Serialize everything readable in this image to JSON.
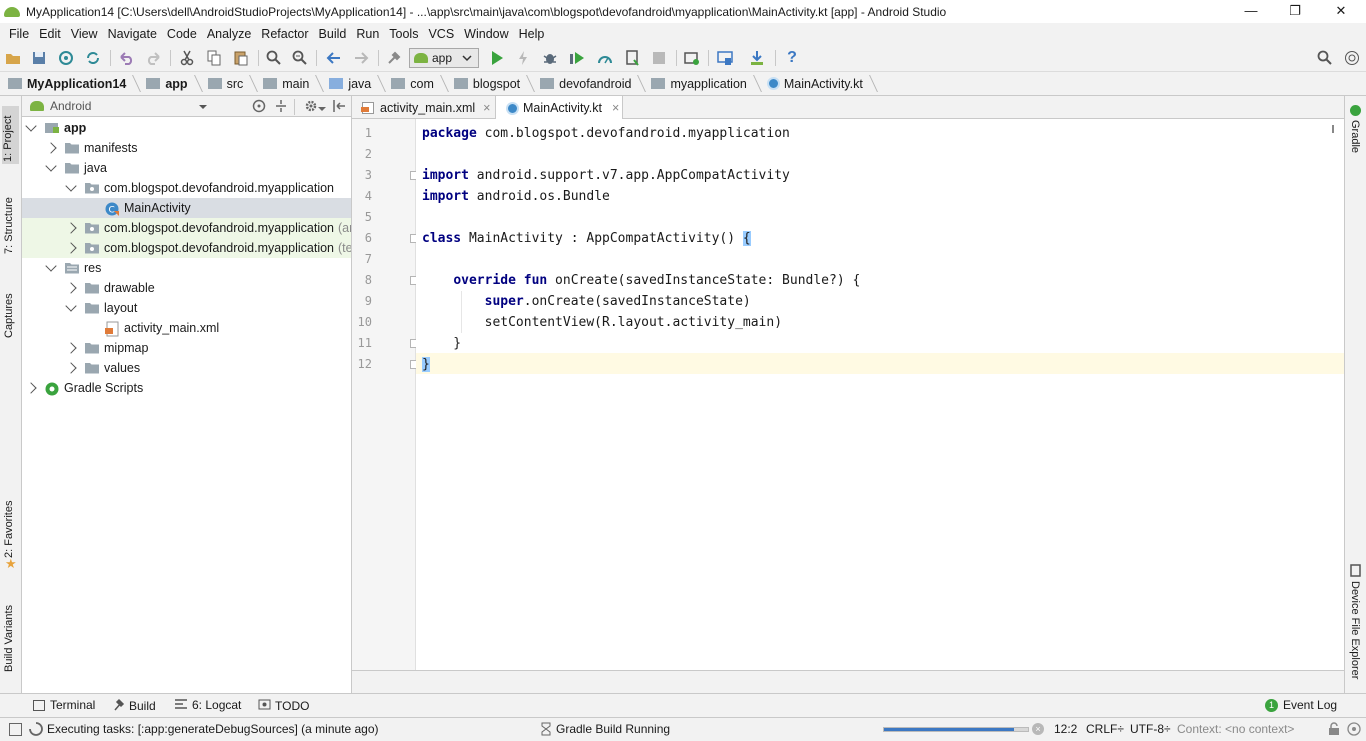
{
  "window": {
    "title": "MyApplication14 [C:\\Users\\dell\\AndroidStudioProjects\\MyApplication14] - ...\\app\\src\\main\\java\\com\\blogspot\\devofandroid\\myapplication\\MainActivity.kt [app] - Android Studio",
    "minimize": "—",
    "maximize": "❐",
    "close": "✕"
  },
  "menu": [
    "File",
    "Edit",
    "View",
    "Navigate",
    "Code",
    "Analyze",
    "Refactor",
    "Build",
    "Run",
    "Tools",
    "VCS",
    "Window",
    "Help"
  ],
  "toolbar": {
    "run_config": "app",
    "help": "?"
  },
  "breadcrumb": [
    "MyApplication14",
    "app",
    "src",
    "main",
    "java",
    "com",
    "blogspot",
    "devofandroid",
    "myapplication",
    "MainActivity.kt"
  ],
  "left_stripe": [
    "1: Project",
    "7: Structure",
    "Captures",
    "2: Favorites",
    "Build Variants"
  ],
  "right_stripe": [
    "Gradle",
    "Device File Explorer"
  ],
  "project_panel": {
    "view_mode": "Android",
    "tree": [
      {
        "label": "app",
        "depth": 0,
        "expanded": true,
        "icon": "module-icon",
        "bold": true
      },
      {
        "label": "manifests",
        "depth": 1,
        "expanded": false,
        "icon": "folder-icon"
      },
      {
        "label": "java",
        "depth": 1,
        "expanded": true,
        "icon": "folder-icon"
      },
      {
        "label": "com.blogspot.devofandroid.myapplication",
        "depth": 2,
        "expanded": true,
        "icon": "package-icon"
      },
      {
        "label": "MainActivity",
        "depth": 3,
        "icon": "kotlin-class-icon",
        "selected": true
      },
      {
        "label": "com.blogspot.devofandroid.myapplication",
        "suffix": "(an",
        "depth": 2,
        "expanded": false,
        "icon": "package-icon",
        "tinted": true
      },
      {
        "label": "com.blogspot.devofandroid.myapplication",
        "suffix": "(tes",
        "depth": 2,
        "expanded": false,
        "icon": "package-icon",
        "tinted": true
      },
      {
        "label": "res",
        "depth": 1,
        "expanded": true,
        "icon": "res-folder-icon"
      },
      {
        "label": "drawable",
        "depth": 2,
        "expanded": false,
        "icon": "folder-icon"
      },
      {
        "label": "layout",
        "depth": 2,
        "expanded": true,
        "icon": "folder-icon"
      },
      {
        "label": "activity_main.xml",
        "depth": 3,
        "icon": "xml-file-icon"
      },
      {
        "label": "mipmap",
        "depth": 2,
        "expanded": false,
        "icon": "folder-icon"
      },
      {
        "label": "values",
        "depth": 2,
        "expanded": false,
        "icon": "folder-icon"
      },
      {
        "label": "Gradle Scripts",
        "depth": 0,
        "expanded": false,
        "icon": "gradle-icon"
      }
    ]
  },
  "editor": {
    "tabs": [
      {
        "label": "activity_main.xml",
        "close": "×",
        "active": false
      },
      {
        "label": "MainActivity.kt",
        "close": "×",
        "active": true
      }
    ],
    "lines": [
      {
        "n": "1",
        "parts": [
          {
            "k": "package"
          },
          {
            "t": " com.blogspot.devofandroid.myapplication"
          }
        ]
      },
      {
        "n": "2",
        "parts": []
      },
      {
        "n": "3",
        "parts": [
          {
            "k": "import"
          },
          {
            "t": " android.support.v7.app.AppCompatActivity"
          }
        ]
      },
      {
        "n": "4",
        "parts": [
          {
            "k": "import"
          },
          {
            "t": " android.os.Bundle"
          }
        ]
      },
      {
        "n": "5",
        "parts": []
      },
      {
        "n": "6",
        "parts": [
          {
            "k": "class"
          },
          {
            "t": " MainActivity : AppCompatActivity() "
          },
          {
            "b": "{"
          }
        ]
      },
      {
        "n": "7",
        "parts": []
      },
      {
        "n": "8",
        "parts": [
          {
            "t": "    "
          },
          {
            "k": "override fun"
          },
          {
            "t": " onCreate(savedInstanceState: Bundle?) {"
          }
        ]
      },
      {
        "n": "9",
        "parts": [
          {
            "t": "        "
          },
          {
            "k": "super"
          },
          {
            "t": ".onCreate(savedInstanceState)"
          }
        ]
      },
      {
        "n": "10",
        "parts": [
          {
            "t": "        setContentView(R.layout.activity_main)"
          }
        ]
      },
      {
        "n": "11",
        "parts": [
          {
            "t": "    }"
          }
        ]
      },
      {
        "n": "12",
        "parts": [
          {
            "b": "}"
          }
        ]
      }
    ]
  },
  "tool_windows": {
    "terminal": "Terminal",
    "build": "Build",
    "logcat": "6: Logcat",
    "todo": "TODO",
    "event_log": "Event Log",
    "event_count": "1"
  },
  "status": {
    "task": "Executing tasks: [:app:generateDebugSources] (a minute ago)",
    "gradle": "Gradle Build Running",
    "progress_fraction": 0.9,
    "position": "12:2",
    "line_sep": "CRLF",
    "encoding": "UTF-8",
    "context": "Context: <no context>"
  },
  "colors": {
    "keyword": "#000080",
    "selection": "#d9dde3",
    "current_line": "#fffae3",
    "tinted_row": "#eef7e6"
  }
}
